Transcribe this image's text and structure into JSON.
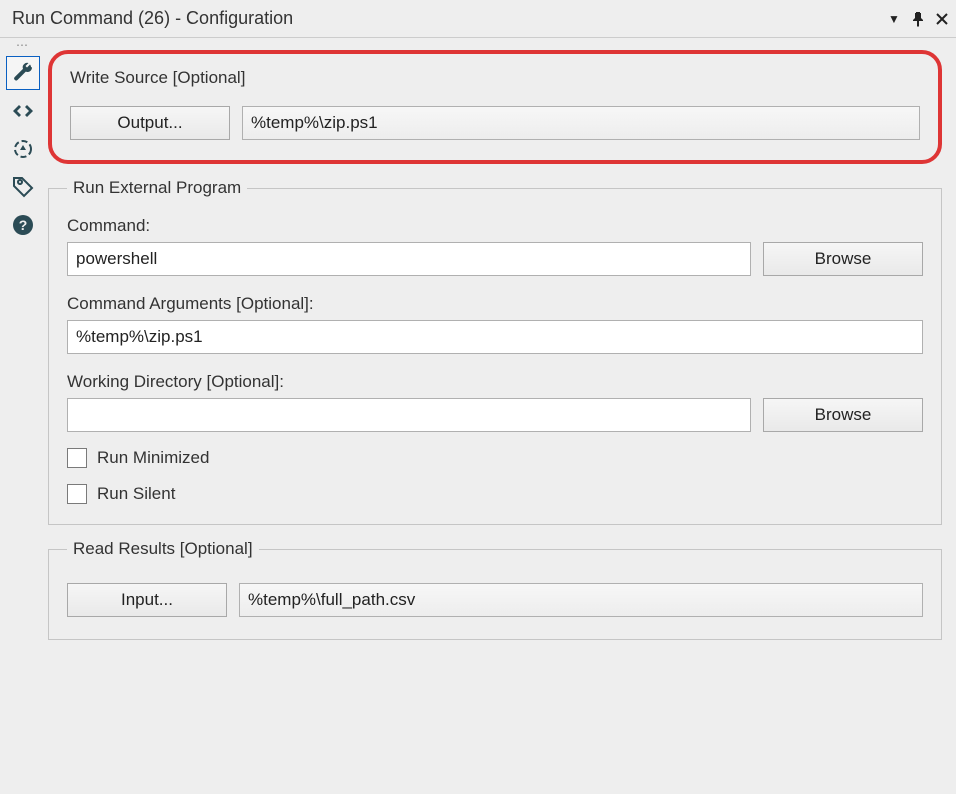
{
  "window": {
    "title": "Run Command (26) - Configuration"
  },
  "write_source": {
    "label": "Write Source [Optional]",
    "output_button": "Output...",
    "path": "%temp%\\zip.ps1"
  },
  "run_external": {
    "legend": "Run External Program",
    "command_label": "Command:",
    "command_value": "powershell",
    "browse_label": "Browse",
    "args_label": "Command Arguments [Optional]:",
    "args_value": "%temp%\\zip.ps1",
    "wd_label": "Working Directory [Optional]:",
    "wd_value": "",
    "run_minimized_label": "Run Minimized",
    "run_silent_label": "Run Silent"
  },
  "read_results": {
    "legend": "Read Results [Optional]",
    "input_button": "Input...",
    "path": "%temp%\\full_path.csv"
  }
}
